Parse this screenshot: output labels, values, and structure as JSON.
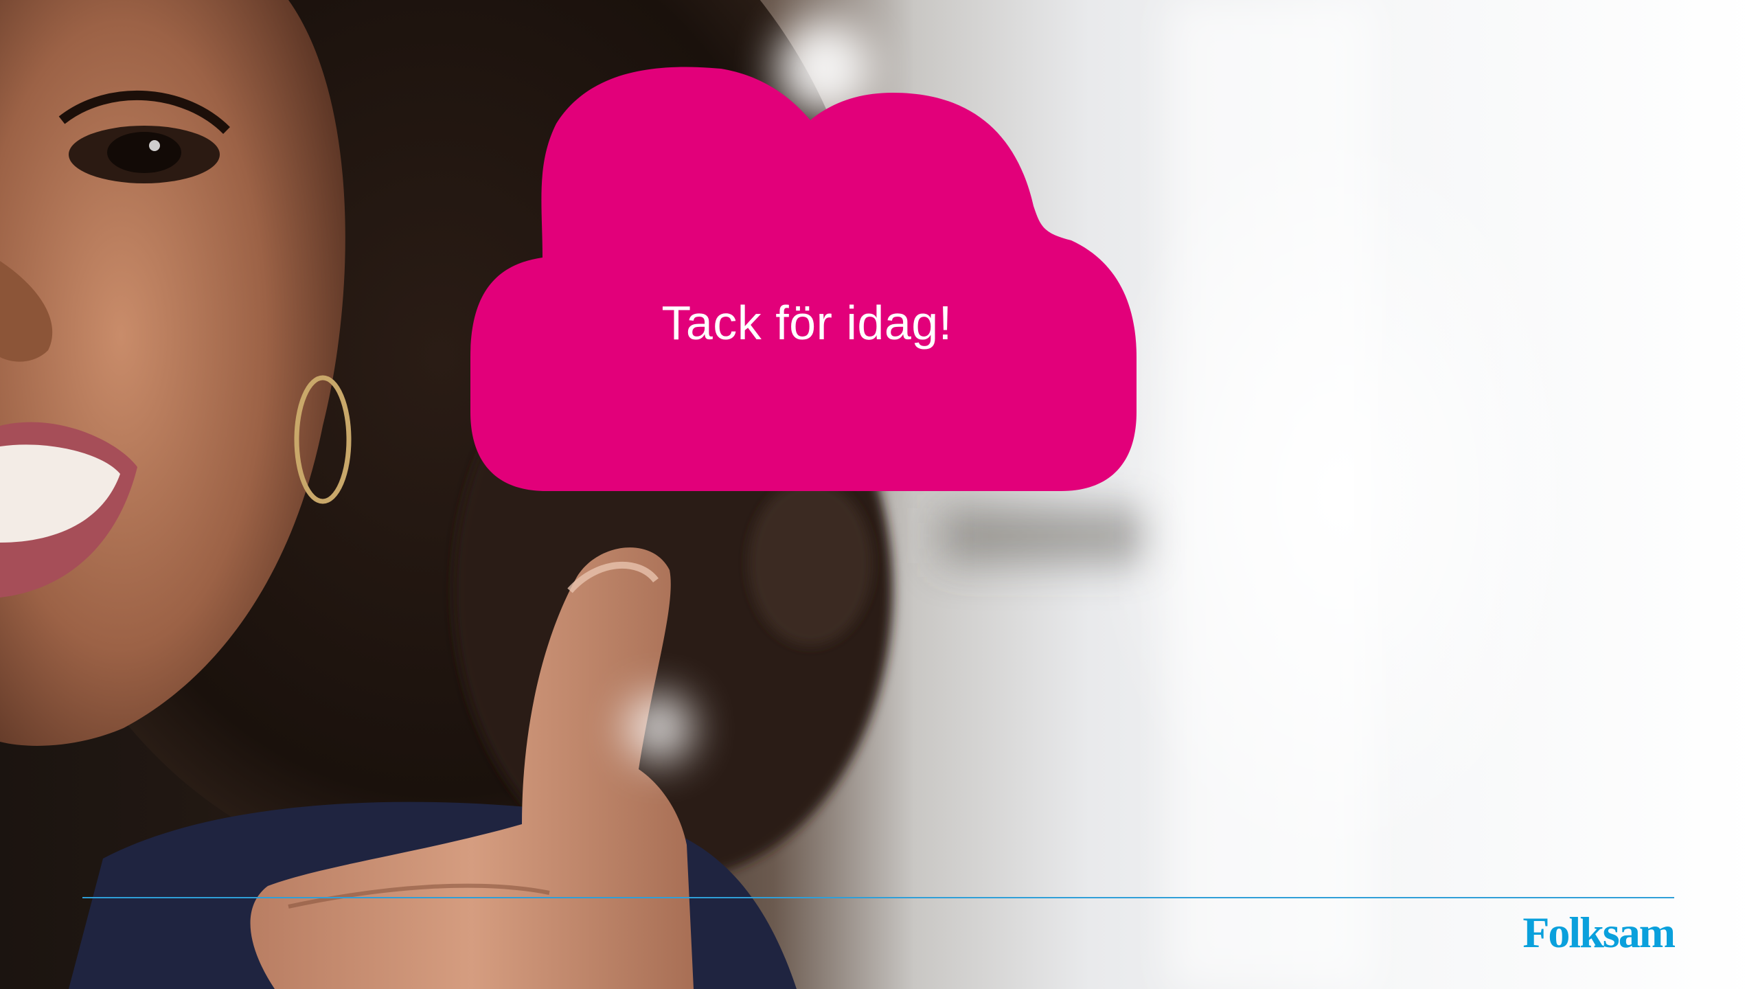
{
  "slide": {
    "message": "Tack för idag!",
    "logo_text": "Folksam"
  },
  "colors": {
    "cloud": "#e2007a",
    "footer_line": "#2f9fd8",
    "logo": "#0aa0dc",
    "message_text": "#ffffff"
  },
  "icons": {
    "cloud": "cloud-shape",
    "photo": "smiling-woman-thumbs-up-photo"
  }
}
